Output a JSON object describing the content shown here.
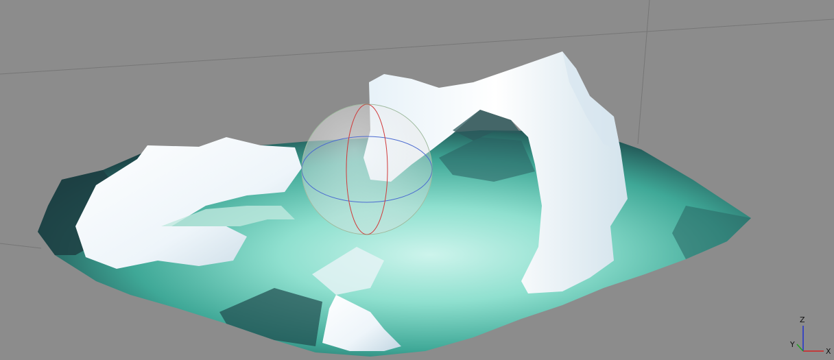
{
  "viewport": {
    "background": "#8c8c8c",
    "model": "iceberg-arch-mesh",
    "gizmo": "rotation-sphere"
  },
  "axes": {
    "x_label": "X",
    "y_label": "Y",
    "z_label": "Z",
    "colors": {
      "x": "#d42020",
      "y": "#20a020",
      "z": "#2030d0"
    }
  },
  "colors": {
    "water_light": "#a8eadc",
    "water_mid": "#5fc9b3",
    "water_dark": "#1f4f52",
    "ice": "#f4f8fb",
    "ice_shadow": "#c7dbe6",
    "grid_line": "#7a7a7a"
  }
}
